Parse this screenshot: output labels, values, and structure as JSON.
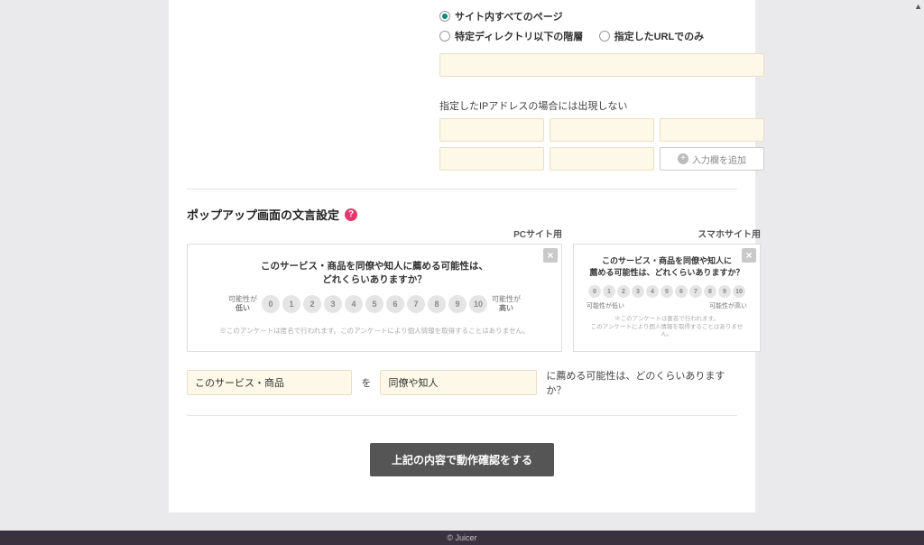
{
  "radios": {
    "all_pages": "サイト内すべてのページ",
    "under_dir": "特定ディレクトリ以下の階層",
    "only_url": "指定したURLでのみ"
  },
  "ip": {
    "label": "指定したIPアドレスの場合には出現しない",
    "add_btn": "入力欄を追加"
  },
  "section": {
    "title": "ポップアップ画面の文言設定"
  },
  "preview": {
    "pc_label": "PCサイト用",
    "sp_label": "スマホサイト用",
    "pc_question_l1": "このサービス・商品を同僚や知人に薦める可能性は、",
    "pc_question_l2": "どれくらいありますか？",
    "sp_question_l1": "このサービス・商品を同僚や知人に",
    "sp_question_l2": "薦める可能性は、どれくらいありますか？",
    "scale_low_l1": "可能性が",
    "scale_low_l2": "低い",
    "scale_high_l1": "可能性が",
    "scale_high_l2": "高い",
    "sp_low": "可能性が低い",
    "sp_high": "可能性が高い",
    "disclaimer_pc": "※このアンケートは匿名で行われます。このアンケートにより個人情報を取得することはありません。",
    "disclaimer_sp_l1": "※このアンケートは匿名で行われます。",
    "disclaimer_sp_l2": "このアンケートにより個人情報を取得することはありません。",
    "scores": [
      "0",
      "1",
      "2",
      "3",
      "4",
      "5",
      "6",
      "7",
      "8",
      "9",
      "10"
    ]
  },
  "sentence": {
    "field1": "このサービス・商品",
    "mid1": "を",
    "field2": "同僚や知人",
    "tail": "に薦める可能性は、どのくらいありますか？"
  },
  "confirm_btn": "上記の内容で動作確認をする",
  "footer": "© Juicer"
}
